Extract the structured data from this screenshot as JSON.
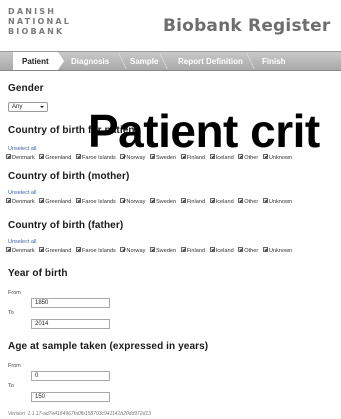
{
  "header": {
    "logo_lines": [
      "DANISH",
      "NATIONAL",
      "BIOBANK"
    ],
    "title": "Biobank Register"
  },
  "nav": {
    "tabs": [
      {
        "label": "Patient",
        "active": true
      },
      {
        "label": "Diagnosis",
        "active": false
      },
      {
        "label": "Sample",
        "active": false
      },
      {
        "label": "Report Definition",
        "active": false
      },
      {
        "label": "Finish",
        "active": false
      }
    ]
  },
  "overlay_title": "Patient crit",
  "gender": {
    "heading": "Gender",
    "selected": "Any"
  },
  "country_birth": {
    "heading": "Country of birth for patient",
    "unselect": "Unselect all"
  },
  "country_mother": {
    "heading": "Country of birth (mother)",
    "unselect": "Unselect all"
  },
  "country_father": {
    "heading": "Country of birth (father)",
    "unselect": "Unselect all"
  },
  "countries": [
    "Denmark",
    "Greenland",
    "Faroe Islands",
    "Norway",
    "Sweden",
    "Finland",
    "Iceland",
    "Other",
    "Unknown"
  ],
  "year_of_birth": {
    "heading": "Year of birth",
    "from_label": "From",
    "from_value": "1850",
    "to_label": "To",
    "to_value": "2014"
  },
  "age_at_sample": {
    "heading": "Age at sample taken (expressed in years)",
    "from_label": "From",
    "from_value": "0",
    "to_label": "To",
    "to_value": "150"
  },
  "version": "Version: 1.1.17-ad7e4184967fa0fb158703c941141b20dd972d13"
}
